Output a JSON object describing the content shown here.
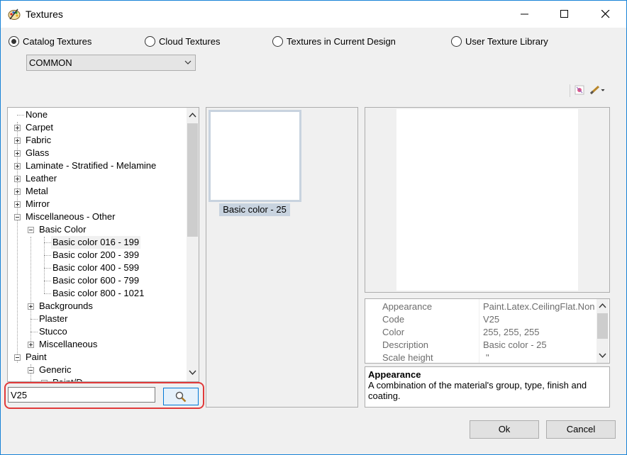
{
  "window": {
    "title": "Textures",
    "icon": "paint-palette-icon",
    "controls": [
      "minimize-icon",
      "maximize-icon",
      "close-icon"
    ]
  },
  "source_options": [
    {
      "label": "Catalog Textures",
      "selected": true
    },
    {
      "label": "Cloud Textures",
      "selected": false
    },
    {
      "label": "Textures in Current Design",
      "selected": false
    },
    {
      "label": "User Texture Library",
      "selected": false
    }
  ],
  "catalog_combo": {
    "value": "COMMON"
  },
  "tree": {
    "items": [
      {
        "label": "None"
      },
      {
        "label": "Carpet"
      },
      {
        "label": "Fabric"
      },
      {
        "label": "Glass"
      },
      {
        "label": "Laminate - Stratified - Melamine"
      },
      {
        "label": "Leather"
      },
      {
        "label": "Metal"
      },
      {
        "label": "Mirror"
      },
      {
        "label": "Miscellaneous - Other"
      },
      {
        "label": "Basic Color"
      },
      {
        "label": "Basic color 016 - 199"
      },
      {
        "label": "Basic color 200 - 399"
      },
      {
        "label": "Basic color 400 - 599"
      },
      {
        "label": "Basic color 600 - 799"
      },
      {
        "label": "Basic color 800 - 1021"
      },
      {
        "label": "Backgrounds"
      },
      {
        "label": "Plaster"
      },
      {
        "label": "Stucco"
      },
      {
        "label": "Miscellaneous"
      },
      {
        "label": "Paint"
      },
      {
        "label": "Generic"
      },
      {
        "label": "Paint/D..."
      }
    ]
  },
  "search": {
    "value": "V25",
    "button_icon": "magnifier-icon"
  },
  "thumbnail": {
    "caption": "Basic color - 25",
    "color": "#ffffff"
  },
  "properties": [
    {
      "name": "Appearance",
      "value": "Paint.Latex.CeilingFlat.Non"
    },
    {
      "name": "Code",
      "value": "V25"
    },
    {
      "name": "Color",
      "value": "255, 255, 255"
    },
    {
      "name": "Description",
      "value": "Basic color - 25"
    },
    {
      "name": "Scale height",
      "value": "\""
    }
  ],
  "description": {
    "title": "Appearance",
    "text": "A combination of the material's group, type, finish and coating."
  },
  "buttons": {
    "ok": "Ok",
    "cancel": "Cancel"
  },
  "toolbar_icons": [
    "texture-settings-icon",
    "brush-dropdown-icon"
  ],
  "colors": {
    "accent": "#0078d7",
    "highlight_frame": "#e03a3a",
    "selection": "#c8d3df"
  }
}
